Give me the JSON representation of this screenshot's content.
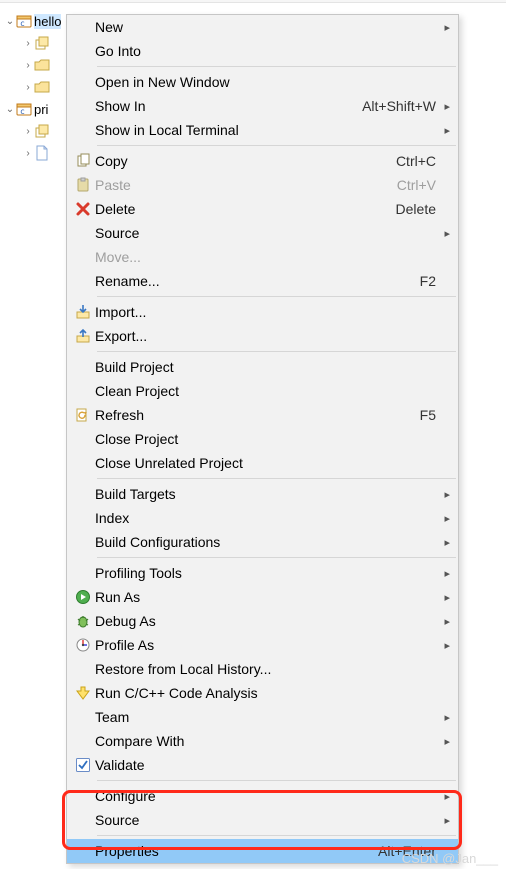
{
  "tree": {
    "items": [
      {
        "label": "hello",
        "expanded": true,
        "icon": "c-project",
        "selected": true,
        "indent": 0
      },
      {
        "label": "",
        "expanded": false,
        "icon": "stack",
        "indent": 1
      },
      {
        "label": "",
        "expanded": false,
        "icon": "folder",
        "indent": 1
      },
      {
        "label": "",
        "expanded": false,
        "icon": "folder",
        "indent": 1
      },
      {
        "label": "pri",
        "expanded": true,
        "icon": "c-project",
        "indent": 0
      },
      {
        "label": "",
        "expanded": false,
        "icon": "stack",
        "indent": 1
      },
      {
        "label": "",
        "expanded": false,
        "icon": "file",
        "indent": 1
      }
    ]
  },
  "menu": {
    "groups": [
      [
        {
          "label": "New",
          "submenu": true
        },
        {
          "label": "Go Into"
        }
      ],
      [
        {
          "label": "Open in New Window"
        },
        {
          "label": "Show In",
          "accel": "Alt+Shift+W",
          "submenu": true
        },
        {
          "label": "Show in Local Terminal",
          "submenu": true
        }
      ],
      [
        {
          "label": "Copy",
          "accel": "Ctrl+C",
          "icon": "copy"
        },
        {
          "label": "Paste",
          "accel": "Ctrl+V",
          "icon": "paste",
          "disabled": true
        },
        {
          "label": "Delete",
          "accel": "Delete",
          "icon": "delete"
        },
        {
          "label": "Source",
          "submenu": true
        },
        {
          "label": "Move...",
          "disabled": true
        },
        {
          "label": "Rename...",
          "accel": "F2"
        }
      ],
      [
        {
          "label": "Import...",
          "icon": "import"
        },
        {
          "label": "Export...",
          "icon": "export"
        }
      ],
      [
        {
          "label": "Build Project"
        },
        {
          "label": "Clean Project"
        },
        {
          "label": "Refresh",
          "accel": "F5",
          "icon": "refresh"
        },
        {
          "label": "Close Project"
        },
        {
          "label": "Close Unrelated Project"
        }
      ],
      [
        {
          "label": "Build Targets",
          "submenu": true
        },
        {
          "label": "Index",
          "submenu": true
        },
        {
          "label": "Build Configurations",
          "submenu": true
        }
      ],
      [
        {
          "label": "Profiling Tools",
          "submenu": true
        },
        {
          "label": "Run As",
          "submenu": true,
          "icon": "run"
        },
        {
          "label": "Debug As",
          "submenu": true,
          "icon": "debug"
        },
        {
          "label": "Profile As",
          "submenu": true,
          "icon": "profile"
        },
        {
          "label": "Restore from Local History..."
        },
        {
          "label": "Run C/C++ Code Analysis",
          "icon": "analysis"
        },
        {
          "label": "Team",
          "submenu": true
        },
        {
          "label": "Compare With",
          "submenu": true
        },
        {
          "label": "Validate",
          "icon": "check"
        }
      ],
      [
        {
          "label": "Configure",
          "submenu": true
        },
        {
          "label": "Source",
          "submenu": true
        }
      ],
      [
        {
          "label": "Properties",
          "accel": "Alt+Enter",
          "highlight": true
        }
      ]
    ]
  },
  "watermark": "CSDN @Jan___"
}
